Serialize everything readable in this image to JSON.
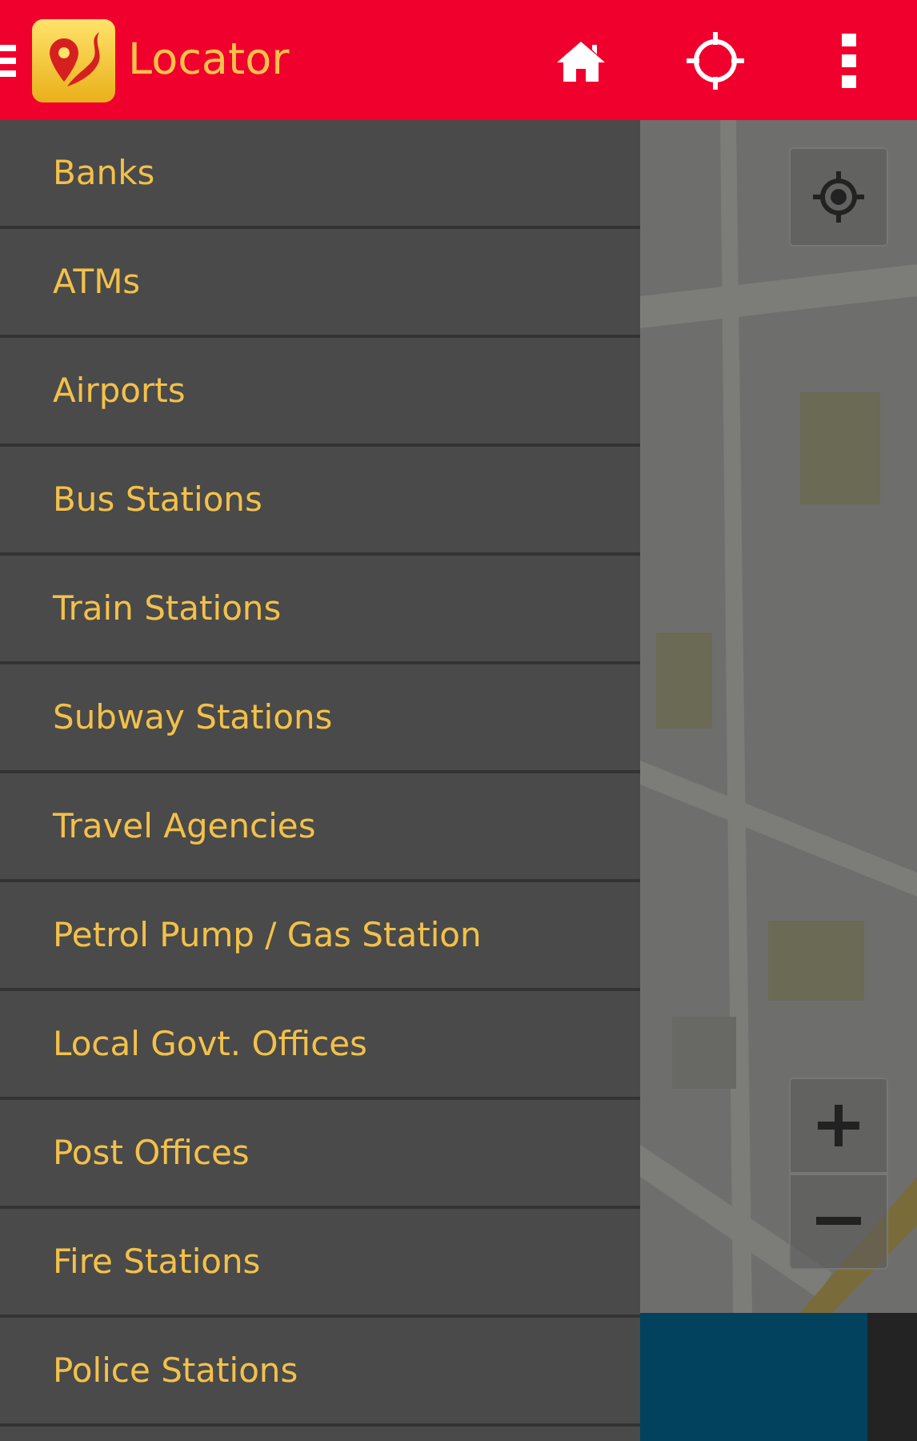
{
  "app_bar": {
    "title": "Locator"
  },
  "drawer": {
    "items": [
      {
        "label": "Banks"
      },
      {
        "label": "ATMs"
      },
      {
        "label": "Airports"
      },
      {
        "label": "Bus Stations"
      },
      {
        "label": "Train Stations"
      },
      {
        "label": "Subway Stations"
      },
      {
        "label": "Travel Agencies"
      },
      {
        "label": "Petrol Pump / Gas Station"
      },
      {
        "label": "Local Govt. Offices"
      },
      {
        "label": "Post Offices"
      },
      {
        "label": "Fire Stations"
      },
      {
        "label": "Police Stations"
      }
    ]
  }
}
